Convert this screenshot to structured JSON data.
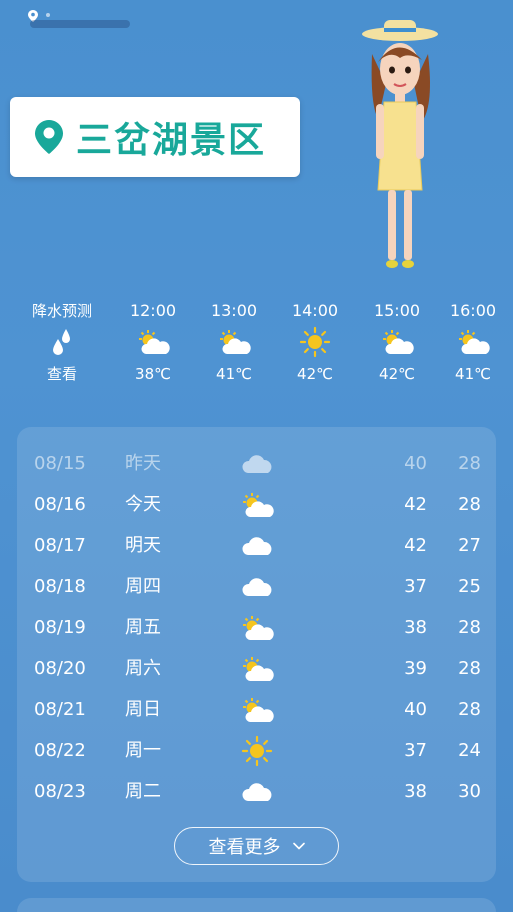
{
  "location": {
    "name": "三岔湖景区"
  },
  "hourly": {
    "precip": {
      "title": "降水预测",
      "action": "查看"
    },
    "hours": [
      {
        "time": "12:00",
        "icon": "partly-cloudy-icon",
        "temp": "38℃"
      },
      {
        "time": "13:00",
        "icon": "partly-cloudy-icon",
        "temp": "41℃"
      },
      {
        "time": "14:00",
        "icon": "sun-icon",
        "temp": "42℃"
      },
      {
        "time": "15:00",
        "icon": "partly-cloudy-icon",
        "temp": "42℃"
      },
      {
        "time": "16:00",
        "icon": "partly-cloudy-icon",
        "temp": "41℃"
      }
    ]
  },
  "daily": {
    "rows": [
      {
        "date": "08/15",
        "day": "昨天",
        "icon": "cloud-icon",
        "high": "40",
        "low": "28",
        "past": true
      },
      {
        "date": "08/16",
        "day": "今天",
        "icon": "partly-cloudy-icon",
        "high": "42",
        "low": "28"
      },
      {
        "date": "08/17",
        "day": "明天",
        "icon": "cloud-icon",
        "high": "42",
        "low": "27"
      },
      {
        "date": "08/18",
        "day": "周四",
        "icon": "cloud-icon",
        "high": "37",
        "low": "25"
      },
      {
        "date": "08/19",
        "day": "周五",
        "icon": "partly-cloudy-icon",
        "high": "38",
        "low": "28"
      },
      {
        "date": "08/20",
        "day": "周六",
        "icon": "partly-cloudy-icon",
        "high": "39",
        "low": "28"
      },
      {
        "date": "08/21",
        "day": "周日",
        "icon": "partly-cloudy-icon",
        "high": "40",
        "low": "28"
      },
      {
        "date": "08/22",
        "day": "周一",
        "icon": "sun-icon",
        "high": "37",
        "low": "24"
      },
      {
        "date": "08/23",
        "day": "周二",
        "icon": "cloud-icon",
        "high": "38",
        "low": "30"
      }
    ],
    "more_label": "查看更多"
  },
  "colors": {
    "accent": "#19a89a",
    "background": "#4a90cf",
    "sun": "#f5c51e"
  }
}
